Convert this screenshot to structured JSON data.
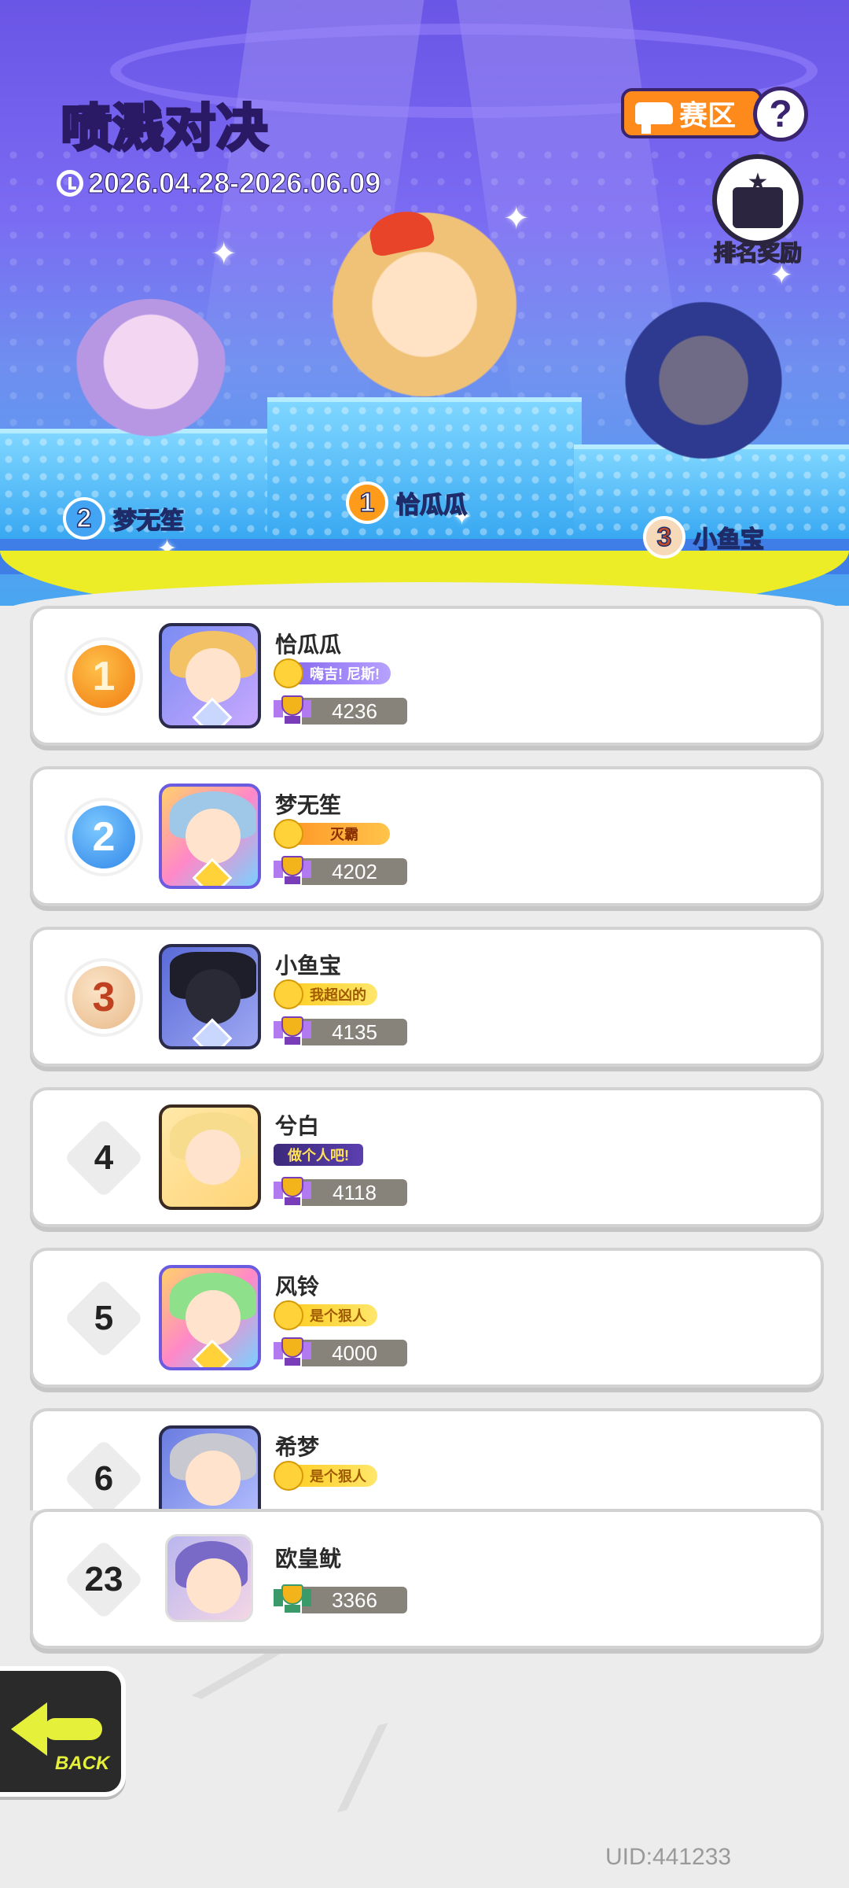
{
  "header": {
    "title_part1": "喷溅",
    "title_part2": "对决",
    "date_range": "2026.04.28-2026.06.09",
    "zone_label": "赛区",
    "help_label": "?",
    "reward_label": "排名奖励"
  },
  "podium": [
    {
      "rank": "1",
      "name": "恰瓜瓜"
    },
    {
      "rank": "2",
      "name": "梦无笙"
    },
    {
      "rank": "3",
      "name": "小鱼宝"
    }
  ],
  "ranking": [
    {
      "rank": "1",
      "name": "恰瓜瓜",
      "title": "嗨吉! 尼斯!",
      "score": "4236"
    },
    {
      "rank": "2",
      "name": "梦无笙",
      "title": "灭霸",
      "score": "4202"
    },
    {
      "rank": "3",
      "name": "小鱼宝",
      "title": "我超凶的",
      "score": "4135"
    },
    {
      "rank": "4",
      "name": "兮白",
      "title": "做个人吧!",
      "score": "4118"
    },
    {
      "rank": "5",
      "name": "风铃",
      "title": "是个狠人",
      "score": "4000"
    },
    {
      "rank": "6",
      "name": "希梦",
      "title": "是个狠人",
      "score": ""
    }
  ],
  "self_row": {
    "rank": "23",
    "name": "欧皇鱿",
    "score": "3366"
  },
  "back_label": "BACK",
  "uid": "UID:441233",
  "colors": {
    "accent_yellow": "#ecec27",
    "stage_purple": "#6a55e6",
    "zone_orange": "#ff8a1c"
  }
}
